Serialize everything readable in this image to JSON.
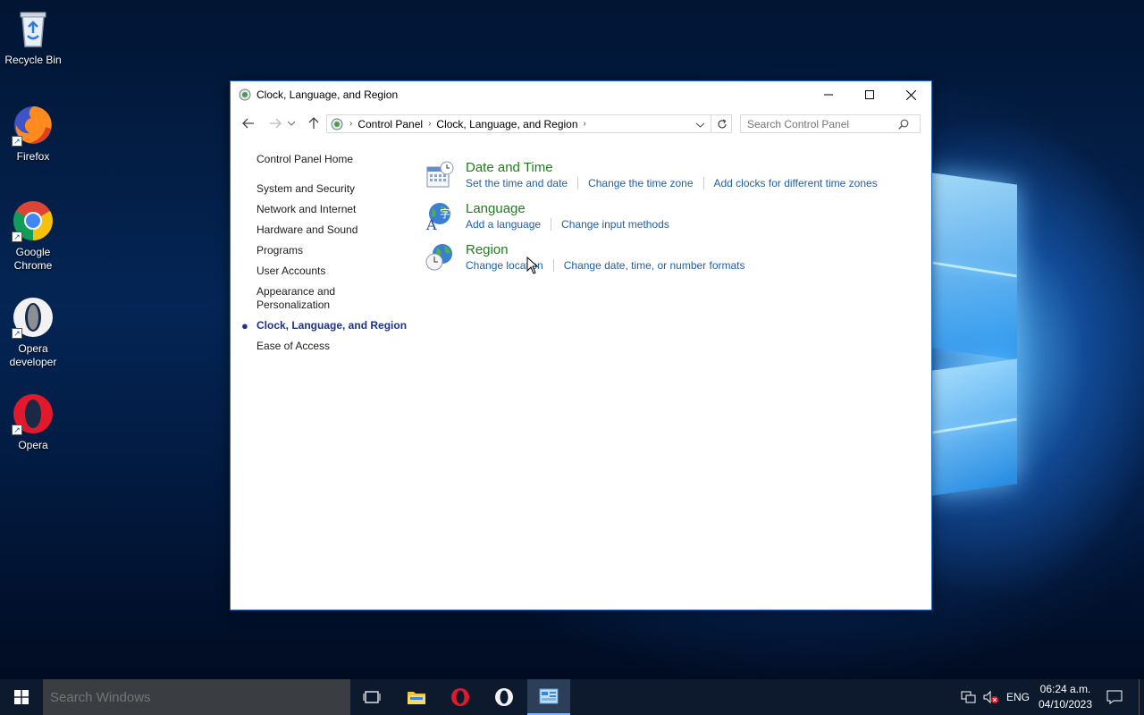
{
  "desktop": {
    "icons": [
      {
        "label": "Recycle Bin",
        "icon": "recycle-bin-icon"
      },
      {
        "label": "Firefox",
        "icon": "firefox-icon"
      },
      {
        "label": "Google Chrome",
        "icon": "chrome-icon"
      },
      {
        "label": "Opera developer",
        "icon": "opera-developer-icon"
      },
      {
        "label": "Opera",
        "icon": "opera-icon"
      }
    ]
  },
  "window": {
    "title": "Clock, Language, and Region",
    "breadcrumbs": [
      "Control Panel",
      "Clock, Language, and Region"
    ],
    "search_placeholder": "Search Control Panel",
    "sidebar": {
      "home": "Control Panel Home",
      "items": [
        "System and Security",
        "Network and Internet",
        "Hardware and Sound",
        "Programs",
        "User Accounts",
        "Appearance and Personalization",
        "Clock, Language, and Region",
        "Ease of Access"
      ],
      "active_index": 6
    },
    "categories": [
      {
        "title": "Date and Time",
        "icon": "date-time-icon",
        "links": [
          "Set the time and date",
          "Change the time zone",
          "Add clocks for different time zones"
        ]
      },
      {
        "title": "Language",
        "icon": "language-icon",
        "links": [
          "Add a language",
          "Change input methods"
        ]
      },
      {
        "title": "Region",
        "icon": "region-icon",
        "links": [
          "Change location",
          "Change date, time, or number formats"
        ]
      }
    ]
  },
  "taskbar": {
    "search_placeholder": "Search Windows",
    "language": "ENG",
    "time": "06:24 a.m.",
    "date": "04/10/2023"
  },
  "colors": {
    "category_title": "#1e7e1e",
    "link": "#1f5fa8",
    "active_nav": "#1e3287",
    "window_border": "#1e6fc9"
  }
}
